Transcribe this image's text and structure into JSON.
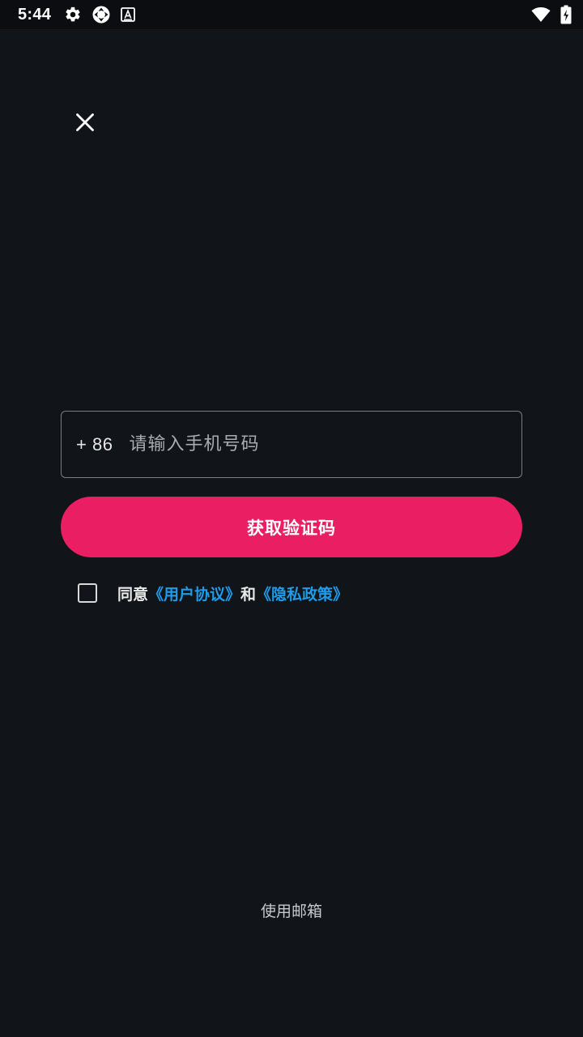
{
  "status_bar": {
    "time": "5:44",
    "icons_left": [
      "gear-icon",
      "sync-icon",
      "keyboard-a-icon"
    ],
    "icons_right": [
      "wifi-icon",
      "battery-charging-icon"
    ]
  },
  "close": {
    "icon": "close-icon"
  },
  "phone": {
    "country_code": "+ 86",
    "value": "",
    "placeholder": "请输入手机号码"
  },
  "primary_button": {
    "label": "获取验证码",
    "color": "#e91e63"
  },
  "agreement": {
    "checked": false,
    "prefix": "同意",
    "user_agreement": "《用户协议》",
    "conjunction": "和",
    "privacy_policy": "《隐私政策》",
    "link_color": "#1e9be9"
  },
  "footer": {
    "use_email": "使用邮箱"
  },
  "colors": {
    "background": "#111418",
    "accent": "#e91e63",
    "link": "#1e9be9"
  }
}
